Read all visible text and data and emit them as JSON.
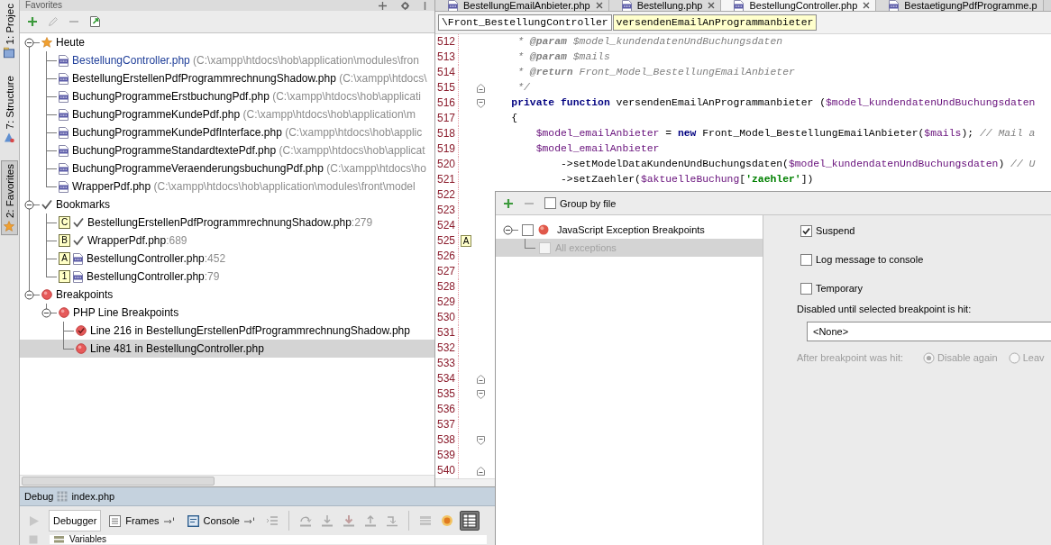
{
  "tool_strip": [
    {
      "label": "1: Projec",
      "kind": "project",
      "selected": false
    },
    {
      "label": "7: Structure",
      "kind": "structure",
      "selected": false
    },
    {
      "label": "2: Favorites",
      "kind": "star",
      "selected": true
    }
  ],
  "favorites": {
    "title": "Favorites",
    "toolbar": [
      {
        "kind": "add",
        "disabled": false
      },
      {
        "kind": "edit",
        "disabled": true
      },
      {
        "kind": "remove",
        "disabled": true
      },
      {
        "kind": "export",
        "disabled": false
      }
    ],
    "tree": [
      {
        "label": "Heute",
        "kind": "star",
        "expanded": true,
        "selected": false,
        "children": [
          {
            "label": "BestellungController.php",
            "path": "(C:\\xampp\\htdocs\\hob\\application\\modules\\fron",
            "kind": "file",
            "color": "#21409a",
            "selected": false
          },
          {
            "label": "BestellungErstellenPdfProgrammrechnungShadow.php",
            "path": "(C:\\xampp\\htdocs\\",
            "kind": "file",
            "color": "#000000",
            "selected": false
          },
          {
            "label": "BuchungProgrammeErstbuchungPdf.php",
            "path": "(C:\\xampp\\htdocs\\hob\\applicati",
            "kind": "file",
            "color": "#000000",
            "selected": false
          },
          {
            "label": "BuchungProgrammeKundePdf.php",
            "path": "(C:\\xampp\\htdocs\\hob\\application\\m",
            "kind": "file",
            "color": "#000000",
            "selected": false
          },
          {
            "label": "BuchungProgrammeKundePdfInterface.php",
            "path": "(C:\\xampp\\htdocs\\hob\\applic",
            "kind": "file",
            "color": "#000000",
            "selected": false
          },
          {
            "label": "BuchungProgrammeStandardtextePdf.php",
            "path": "(C:\\xampp\\htdocs\\hob\\applicat",
            "kind": "file",
            "color": "#000000",
            "selected": false
          },
          {
            "label": "BuchungProgrammeVeraenderungsbuchungPdf.php",
            "path": "(C:\\xampp\\htdocs\\ho",
            "kind": "file",
            "color": "#000000",
            "selected": false
          },
          {
            "label": "WrapperPdf.php",
            "path": "(C:\\xampp\\htdocs\\hob\\application\\modules\\front\\model",
            "kind": "file",
            "color": "#000000",
            "selected": false
          }
        ]
      },
      {
        "label": "Bookmarks",
        "kind": "check",
        "expanded": true,
        "selected": false,
        "children": [
          {
            "mnemonic": "C",
            "kind": "check",
            "label": "BestellungErstellenPdfProgrammrechnungShadow.php",
            "line": ":279",
            "selected": false
          },
          {
            "mnemonic": "B",
            "kind": "check",
            "label": "WrapperPdf.php",
            "line": ":689",
            "selected": false
          },
          {
            "mnemonic": "A",
            "kind": "file",
            "label": "BestellungController.php",
            "line": ":452",
            "selected": false
          },
          {
            "mnemonic": "1",
            "kind": "file",
            "label": "BestellungController.php",
            "line": ":79",
            "selected": false
          }
        ]
      },
      {
        "label": "Breakpoints",
        "kind": "breakpoint",
        "expanded": true,
        "selected": false,
        "children": [
          {
            "label": "PHP Line Breakpoints",
            "kind": "breakpoint",
            "expanded": true,
            "selected": false,
            "children": [
              {
                "label": "Line 216 in BestellungErstellenPdfProgrammrechnungShadow.php",
                "kind": "breakpoint-check",
                "selected": false
              },
              {
                "label": "Line 481 in BestellungController.php",
                "kind": "breakpoint",
                "selected": true
              }
            ]
          }
        ]
      }
    ]
  },
  "editor": {
    "tabs": [
      {
        "label": "BestellungEmailAnbieter.php",
        "selected": false,
        "closable": true
      },
      {
        "label": "Bestellung.php",
        "selected": false,
        "closable": true
      },
      {
        "label": "BestellungController.php",
        "selected": true,
        "closable": true
      },
      {
        "label": "BestaetigungPdfProgramme.p",
        "selected": false,
        "closable": false
      }
    ],
    "breadcrumbs": [
      {
        "label": "\\Front_BestellungController",
        "selected": false
      },
      {
        "label": "versendenEmailAnProgrammanbieter",
        "selected": true
      }
    ],
    "lines": [
      {
        "number": "512",
        "kind": "plain",
        "tokens": [
          {
            "text": "     * ",
            "kind": "comment"
          },
          {
            "text": "@param",
            "kind": "doctag"
          },
          {
            "text": " $model_kundendatenUndBuchungsdaten",
            "kind": "comment"
          }
        ]
      },
      {
        "number": "513",
        "kind": "plain",
        "tokens": [
          {
            "text": "     * ",
            "kind": "comment"
          },
          {
            "text": "@param",
            "kind": "doctag"
          },
          {
            "text": " $mails",
            "kind": "comment"
          }
        ]
      },
      {
        "number": "514",
        "kind": "plain",
        "tokens": [
          {
            "text": "     * ",
            "kind": "comment"
          },
          {
            "text": "@return",
            "kind": "doctag"
          },
          {
            "text": " Front_Model_BestellungEmailAnbieter",
            "kind": "comment"
          }
        ]
      },
      {
        "number": "515",
        "kind": "fold-end",
        "tokens": [
          {
            "text": "     */",
            "kind": "comment"
          }
        ]
      },
      {
        "number": "516",
        "kind": "fold-start",
        "tokens": [
          {
            "text": "    private",
            "kind": "keyword"
          },
          {
            "text": " function",
            "kind": "keyword"
          },
          {
            "text": " versendenEmailAnProgrammanbieter (",
            "kind": "plain"
          },
          {
            "text": "$model_kundendatenUndBuchungsdaten",
            "kind": "variable"
          }
        ]
      },
      {
        "number": "517",
        "kind": "plain",
        "tokens": [
          {
            "text": "    {",
            "kind": "plain"
          }
        ]
      },
      {
        "number": "518",
        "kind": "plain",
        "tokens": [
          {
            "text": "        $model_emailAnbieter",
            "kind": "variable"
          },
          {
            "text": " = ",
            "kind": "plain"
          },
          {
            "text": "new",
            "kind": "keyword"
          },
          {
            "text": " Front_Model_BestellungEmailAnbieter(",
            "kind": "plain"
          },
          {
            "text": "$mails",
            "kind": "variable"
          },
          {
            "text": "); ",
            "kind": "plain"
          },
          {
            "text": "// Mail a",
            "kind": "comment"
          }
        ]
      },
      {
        "number": "519",
        "kind": "plain",
        "tokens": [
          {
            "text": "        $model_emailAnbieter",
            "kind": "variable"
          }
        ]
      },
      {
        "number": "520",
        "kind": "plain",
        "tokens": [
          {
            "text": "            ->setModelDataKundenUndBuchungsdaten(",
            "kind": "plain"
          },
          {
            "text": "$model_kundendatenUndBuchungsdaten",
            "kind": "variable"
          },
          {
            "text": ") ",
            "kind": "plain"
          },
          {
            "text": "// U",
            "kind": "comment"
          }
        ]
      },
      {
        "number": "521",
        "kind": "plain",
        "tokens": [
          {
            "text": "            ->setZaehler(",
            "kind": "plain"
          },
          {
            "text": "$aktuelleBuchung",
            "kind": "variable"
          },
          {
            "text": "[",
            "kind": "plain"
          },
          {
            "text": "'zaehler'",
            "kind": "string"
          },
          {
            "text": "])",
            "kind": "plain"
          }
        ]
      },
      {
        "number": "522",
        "kind": "plain"
      },
      {
        "number": "523",
        "kind": "plain"
      },
      {
        "number": "524",
        "kind": "plain"
      },
      {
        "number": "525",
        "kind": "plain",
        "bookmark": "A"
      },
      {
        "number": "526",
        "kind": "plain"
      },
      {
        "number": "527",
        "kind": "plain"
      },
      {
        "number": "528",
        "kind": "plain"
      },
      {
        "number": "529",
        "kind": "plain"
      },
      {
        "number": "530",
        "kind": "plain"
      },
      {
        "number": "531",
        "kind": "plain"
      },
      {
        "number": "532",
        "kind": "plain"
      },
      {
        "number": "533",
        "kind": "plain"
      },
      {
        "number": "534",
        "kind": "fold-end"
      },
      {
        "number": "535",
        "kind": "fold-start"
      },
      {
        "number": "536",
        "kind": "plain"
      },
      {
        "number": "537",
        "kind": "plain"
      },
      {
        "number": "538",
        "kind": "fold-start"
      },
      {
        "number": "539",
        "kind": "plain"
      },
      {
        "number": "540",
        "kind": "fold-end"
      }
    ]
  },
  "debug": {
    "title": "Debug",
    "session": "index.php",
    "side_tools": [
      {
        "kind": "resume",
        "disabled": true
      },
      {
        "kind": "stop",
        "disabled": true
      }
    ],
    "tabs": [
      {
        "kind": "debugger",
        "label": "Debugger",
        "selected": true
      },
      {
        "kind": "frames",
        "label": "Frames",
        "selected": false
      },
      {
        "kind": "console",
        "label": "Console",
        "selected": false
      }
    ],
    "tool_groups": [
      [
        {
          "kind": "lines",
          "disabled": true,
          "on": false
        }
      ],
      [
        {
          "kind": "step-over",
          "disabled": true,
          "on": false
        },
        {
          "kind": "step-into",
          "disabled": true,
          "on": false
        },
        {
          "kind": "force-step-into",
          "disabled": true,
          "on": false
        },
        {
          "kind": "step-out",
          "disabled": true,
          "on": false
        },
        {
          "kind": "run-to-cursor",
          "disabled": true,
          "on": false
        }
      ],
      [
        {
          "kind": "evaluate",
          "disabled": true,
          "on": false
        },
        {
          "kind": "breakpoints",
          "disabled": false,
          "on": false
        },
        {
          "kind": "layout",
          "disabled": false,
          "on": true
        }
      ]
    ],
    "variables": "Variables"
  },
  "breakpoints_dialog": {
    "toolbar": [
      {
        "kind": "add",
        "disabled": false
      },
      {
        "kind": "remove",
        "disabled": true
      }
    ],
    "group_by_file": {
      "label": "Group by file",
      "checked": false
    },
    "tree": [
      {
        "label": "JavaScript Exception Breakpoints",
        "kind": "exception",
        "checked": false,
        "disabled": false,
        "expanded": true,
        "selected": false,
        "children": [
          {
            "label": "All exceptions",
            "checked": false,
            "disabled": true,
            "selected": true
          }
        ]
      }
    ],
    "options": [
      {
        "label": "Suspend",
        "checked": true
      },
      {
        "label": "Log message to console",
        "checked": false
      },
      {
        "label": "Temporary",
        "checked": false
      }
    ],
    "condition": {
      "label": "Disabled until selected breakpoint is hit:",
      "value": "<None>"
    },
    "after_hit": {
      "label": "After breakpoint was hit:",
      "disabled": true,
      "choices": [
        {
          "label": "Disable again",
          "selected": true
        },
        {
          "label": "Leav",
          "selected": false
        }
      ]
    }
  }
}
